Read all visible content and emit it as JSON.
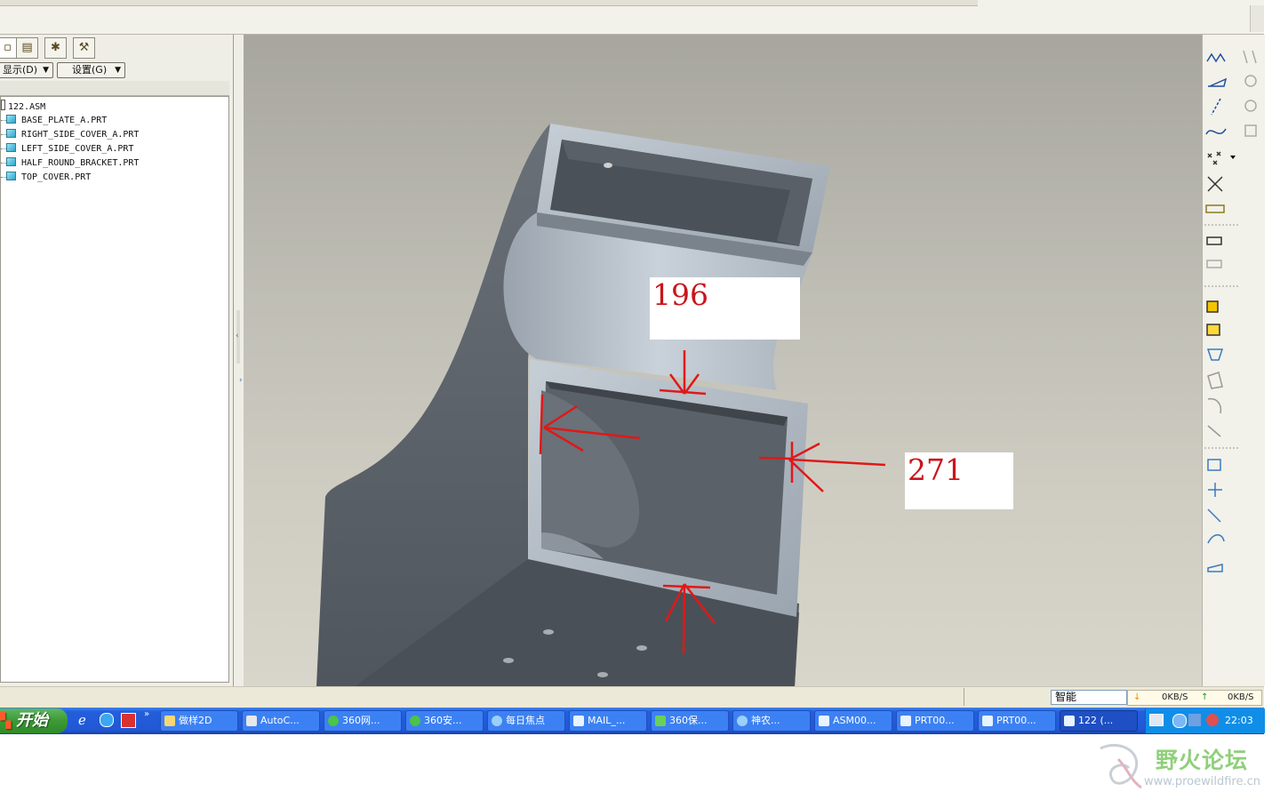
{
  "left_panel": {
    "tabs": [
      "model-tree",
      "layers",
      "favorites",
      "tools"
    ],
    "show_menu_label": "显示(D)",
    "settings_menu_label": "设置(G)"
  },
  "model_tree": {
    "root": "122.ASM",
    "items": [
      "BASE_PLATE_A.PRT",
      "RIGHT_SIDE_COVER_A.PRT",
      "LEFT_SIDE_COVER_A.PRT",
      "HALF_ROUND_BRACKET.PRT",
      "TOP_COVER.PRT"
    ]
  },
  "annotations": {
    "dimension_1": "196",
    "dimension_2": "271",
    "color": "#c8161c"
  },
  "status_bar": {
    "filter_value": "智能",
    "download_speed": "0KB/S",
    "upload_speed": "0KB/S"
  },
  "taskbar": {
    "start_label": "开始",
    "buttons": [
      {
        "label": "做样2D",
        "icon": "folder-icon"
      },
      {
        "label": "AutoC...",
        "icon": "autocad-icon"
      },
      {
        "label": "360网...",
        "icon": "browser-360-icon"
      },
      {
        "label": "360安...",
        "icon": "security-360-icon"
      },
      {
        "label": "每日焦点",
        "icon": "news-icon"
      },
      {
        "label": "MAIL_...",
        "icon": "window-icon"
      },
      {
        "label": "360保...",
        "icon": "shield-icon"
      },
      {
        "label": "神农...",
        "icon": "browser-icon"
      },
      {
        "label": "ASM00...",
        "icon": "window-icon"
      },
      {
        "label": "PRT00...",
        "icon": "window-icon"
      },
      {
        "label": "PRT00...",
        "icon": "window-icon"
      },
      {
        "label": "122 (...",
        "icon": "window-icon"
      }
    ],
    "clock": "22:03"
  },
  "watermark": {
    "title": "野火论坛",
    "url": "www.proewildfire.cn"
  },
  "colors": {
    "taskbar_blue": "#245edb",
    "start_green": "#3c9a36",
    "model_gray": "#5a5f66"
  }
}
